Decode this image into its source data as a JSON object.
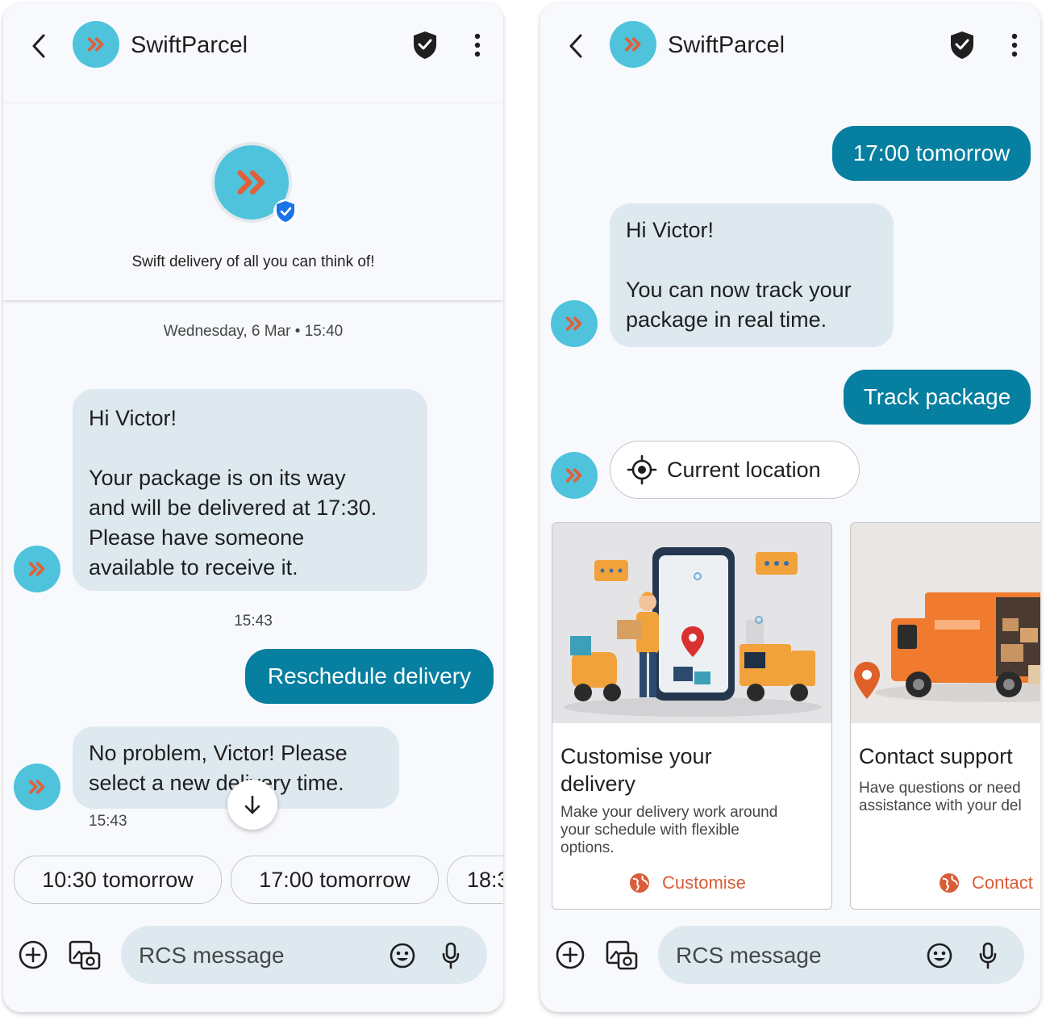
{
  "left": {
    "header": {
      "title": "SwiftParcel"
    },
    "profile": {
      "tagline": "Swift delivery of all you can think of!"
    },
    "date_separator": "Wednesday, 6 Mar • 15:40",
    "messages": {
      "first": "Hi Victor!\n\nYour package is on its way\nand will be delivered at 17:30.\nPlease have someone\navailable to receive it.",
      "first_time": "15:43",
      "reply": "Reschedule delivery",
      "second": "No problem, Victor! Please\nselect a new delivery time.",
      "second_time": "15:43"
    },
    "suggestions": [
      "10:30 tomorrow",
      "17:00 tomorrow",
      "18:3"
    ],
    "input": {
      "placeholder": "RCS message"
    }
  },
  "right": {
    "header": {
      "title": "SwiftParcel"
    },
    "messages": {
      "reply1": "17:00 tomorrow",
      "incoming": "Hi Victor!\n\nYou can now track your\npackage in real time.",
      "reply2": "Track package",
      "location_chip": "Current location"
    },
    "cards": [
      {
        "title": "Customise your\ndelivery",
        "description": "Make your delivery work around\nyour schedule with flexible\noptions.",
        "action": "Customise"
      },
      {
        "title": "Contact support",
        "description": "Have questions or need\nassistance with your del",
        "action": "Contact"
      }
    ],
    "input": {
      "placeholder": "RCS message"
    }
  },
  "colors": {
    "brand": "#4fc3dc",
    "brand_arrow": "#e0603a",
    "outgoing_bubble": "#067fa0",
    "incoming_bubble": "#dde9ef",
    "verified_badge": "#1a73e8",
    "card_action": "#d95d39"
  },
  "icons": [
    "back-arrow-icon",
    "shield-check-icon",
    "more-vert-icon",
    "verified-check-icon",
    "scroll-down-icon",
    "add-circle-icon",
    "gallery-icon",
    "emoji-icon",
    "mic-icon",
    "my-location-icon",
    "globe-icon",
    "location-pin-icon"
  ]
}
